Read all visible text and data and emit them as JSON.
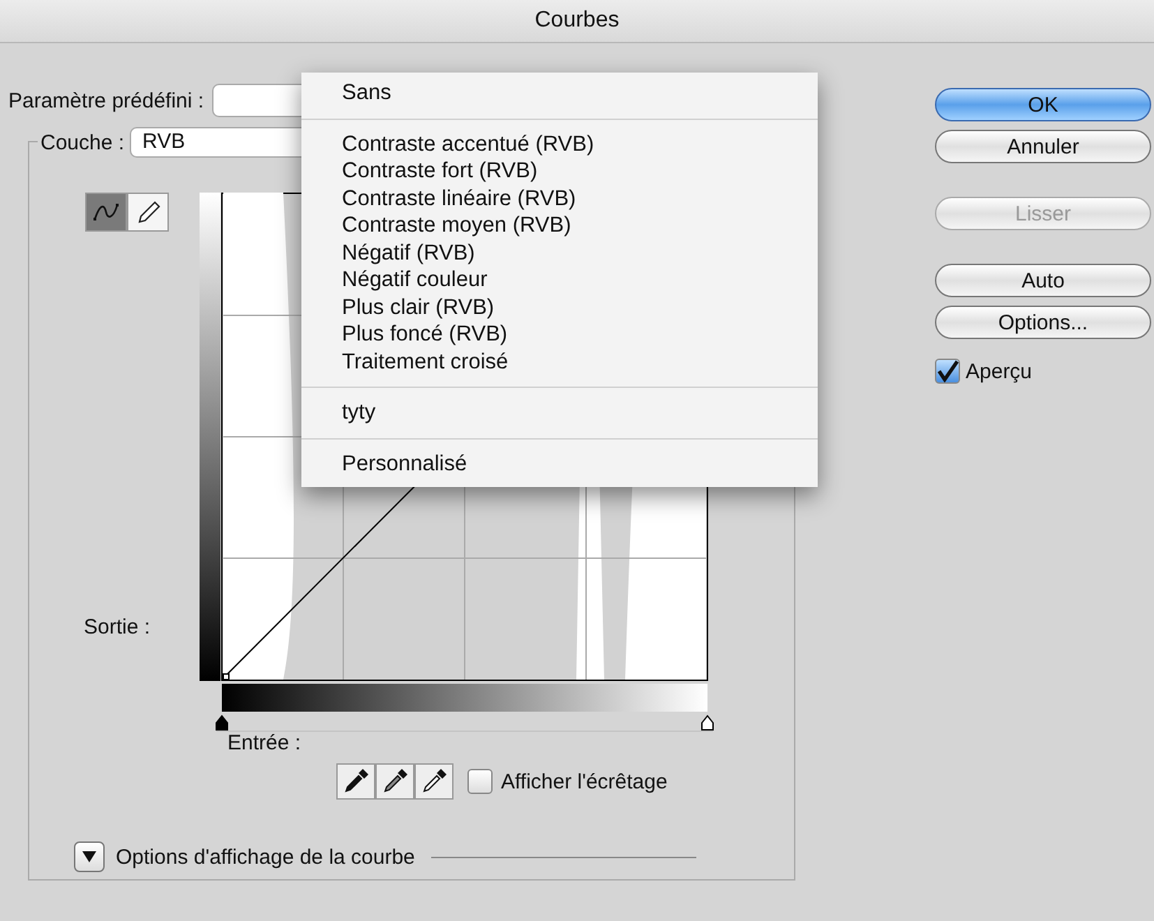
{
  "window": {
    "title": "Courbes"
  },
  "preset": {
    "label": "Paramètre prédéfini :"
  },
  "preset_menu": {
    "groups": [
      [
        {
          "label": "Sans"
        }
      ],
      [
        {
          "label": "Contraste accentué (RVB)"
        },
        {
          "label": "Contraste fort (RVB)"
        },
        {
          "label": "Contraste linéaire (RVB)"
        },
        {
          "label": "Contraste moyen (RVB)"
        },
        {
          "label": "Négatif (RVB)"
        },
        {
          "label": "Négatif couleur"
        },
        {
          "label": "Plus clair (RVB)"
        },
        {
          "label": "Plus foncé (RVB)"
        },
        {
          "label": "Traitement croisé"
        }
      ],
      [
        {
          "label": "tyty"
        }
      ],
      [
        {
          "label": "Personnalisé"
        }
      ]
    ]
  },
  "channel": {
    "label": "Couche :",
    "value": "RVB"
  },
  "tools": [
    {
      "kind": "curve",
      "selected": true
    },
    {
      "kind": "pencil",
      "selected": false
    }
  ],
  "graph": {
    "output_label": "Sortie :",
    "input_label": "Entrée :"
  },
  "input_sliders": [
    {
      "kind": "shadow",
      "level": 0
    },
    {
      "kind": "highlight",
      "level": 1
    }
  ],
  "eyedroppers": [
    {
      "kind": "black"
    },
    {
      "kind": "gray"
    },
    {
      "kind": "white"
    }
  ],
  "clipping": {
    "label": "Afficher l'écrêtage",
    "checked": false
  },
  "display_options": {
    "label": "Options d'affichage de la courbe",
    "expanded": false
  },
  "buttons": [
    [
      {
        "label": "OK",
        "kind": "default",
        "disabled": false
      },
      {
        "label": "Annuler",
        "kind": "normal",
        "disabled": false
      }
    ],
    [
      {
        "label": "Lisser",
        "kind": "normal",
        "disabled": true
      }
    ],
    [
      {
        "label": "Auto",
        "kind": "normal",
        "disabled": false
      },
      {
        "label": "Options...",
        "kind": "normal",
        "disabled": false
      }
    ]
  ],
  "preview": {
    "label": "Aperçu",
    "checked": true
  }
}
